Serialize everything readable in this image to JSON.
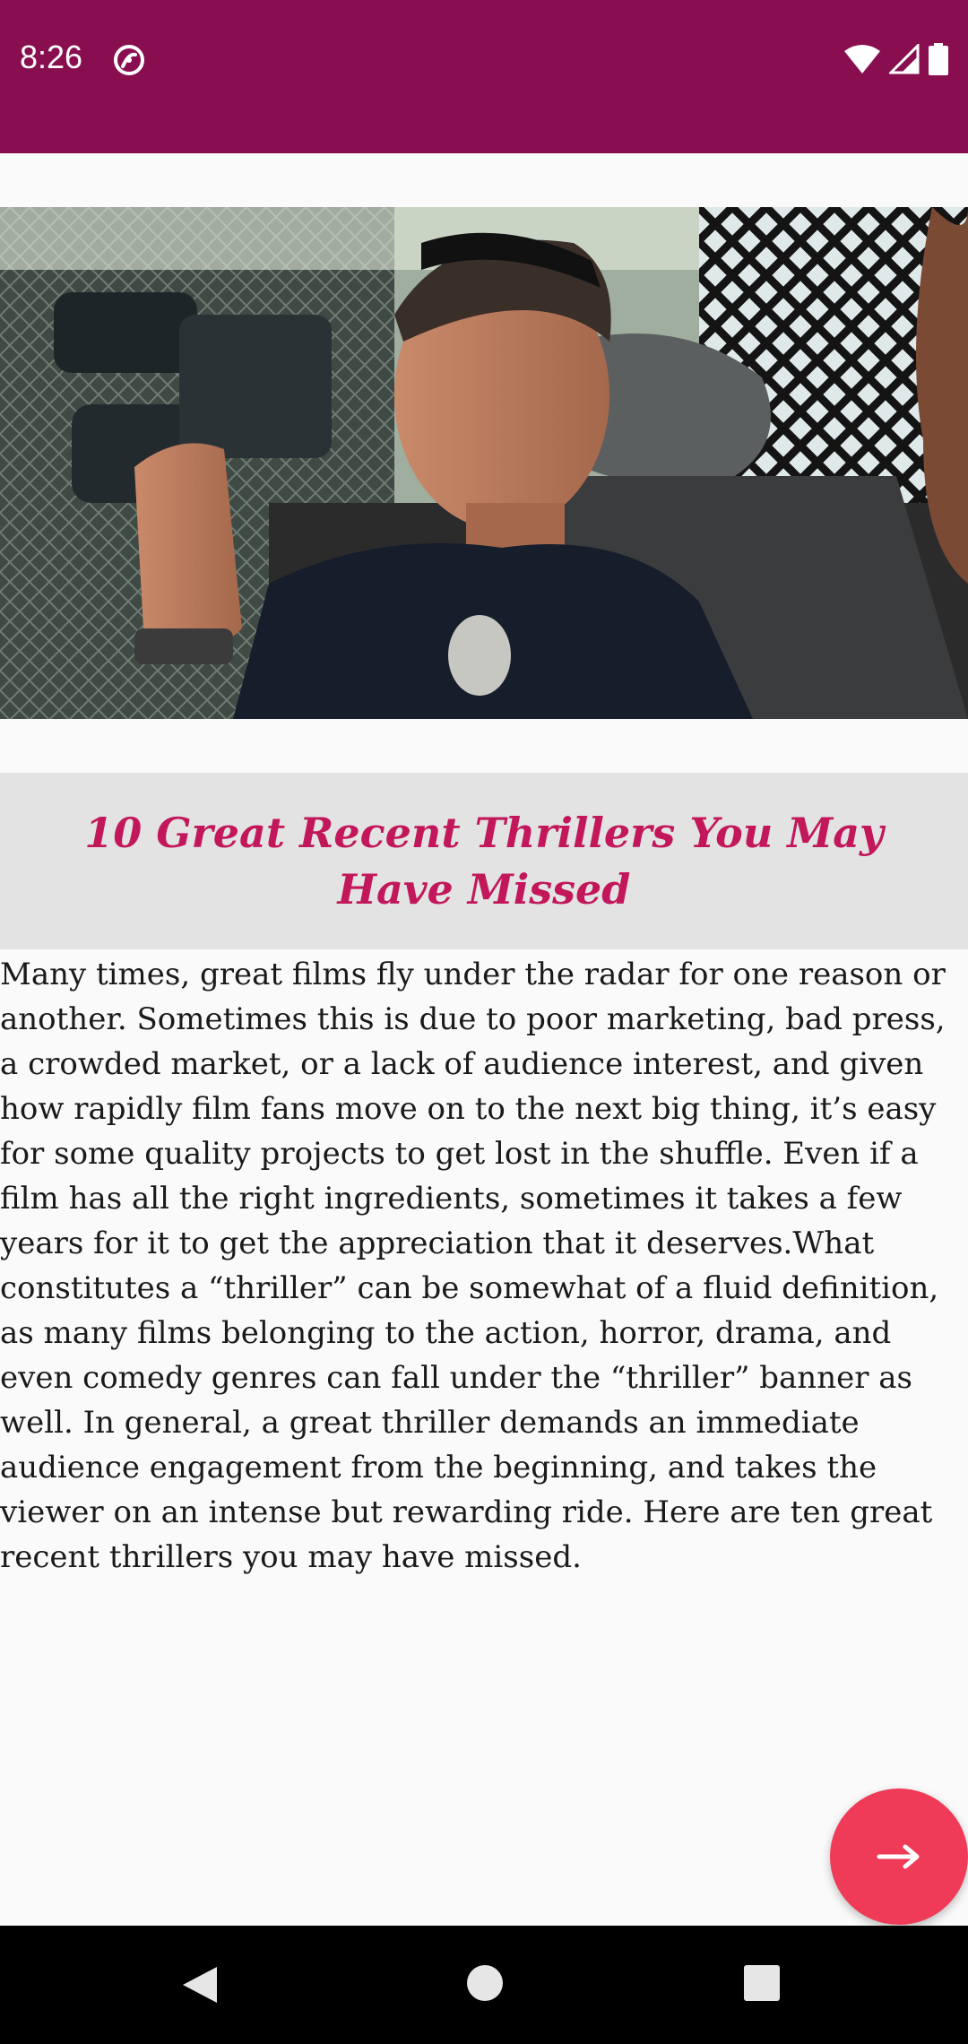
{
  "status_bar": {
    "time": "8:26",
    "background_color": "#880e4f",
    "icons": [
      "sync-icon",
      "wifi-icon",
      "cell-signal-icon",
      "battery-icon"
    ]
  },
  "hero": {
    "icon": "photo-police-officer-binoculars"
  },
  "article": {
    "title": "10 Great Recent Thrillers You May Have Missed",
    "title_color": "#c2185b",
    "body": "Many times, great films fly under the radar for one reason or another. Sometimes this is due to poor marketing, bad press, a crowded market, or a lack of audience interest, and given how rapidly film fans move on to the next big thing, it’s easy for some quality projects to get lost in the shuffle. Even if a film has all the right ingredients, sometimes it takes a few years for it to get the appreciation that it deserves.What constitutes a “thriller” can be somewhat of a fluid definition, as many films belonging to the action, horror, drama, and even comedy genres can fall under the “thriller” banner as well. In general, a great thriller demands an immediate audience engagement from the beginning, and takes the viewer on an intense but rewarding ride. Here are ten great recent thrillers you may have missed."
  },
  "fab": {
    "icon": "arrow-right-icon",
    "color": "#ef3b57"
  },
  "nav_bar": {
    "icons": [
      "back-icon",
      "home-icon",
      "recents-icon"
    ]
  }
}
